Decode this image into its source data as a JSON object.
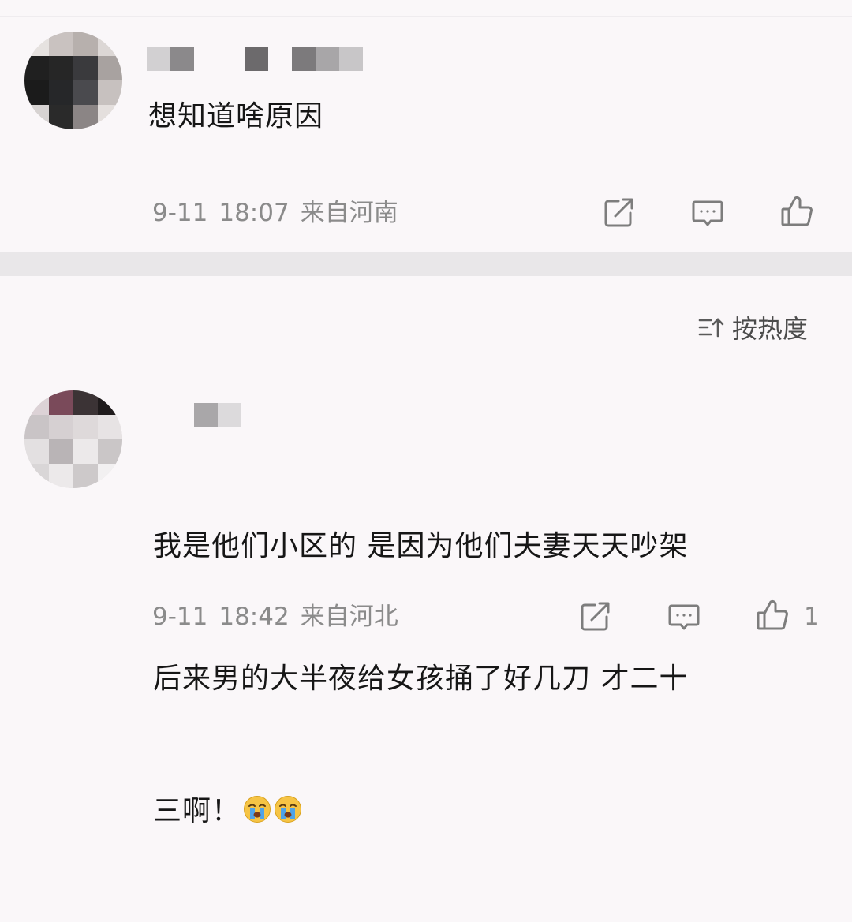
{
  "sort": {
    "label": "按热度",
    "icon": "sort-icon"
  },
  "comments": [
    {
      "text_lines": [
        "想知道啥原因"
      ],
      "date": "9-11",
      "time": "18:07",
      "location": "来自河南",
      "like_count": ""
    },
    {
      "text_lines": [
        "我是他们小区的 是因为他们夫妻天天吵架",
        "后来男的大半夜给女孩捅了好几刀 才二十",
        "三啊！"
      ],
      "emoji": [
        "crying-face-emoji",
        "crying-face-emoji"
      ],
      "date": "9-11",
      "time": "18:42",
      "location": "来自河北",
      "like_count": "1"
    }
  ],
  "icons": [
    "share-icon",
    "reply-icon",
    "like-icon"
  ],
  "colors": {
    "background": "#faf7f9",
    "divider": "#e9e7e9",
    "meta_text": "#8b8b8b",
    "icon": "#7d7d7d",
    "emoji_face": "#f6c445",
    "emoji_tears": "#4fa3e8"
  }
}
